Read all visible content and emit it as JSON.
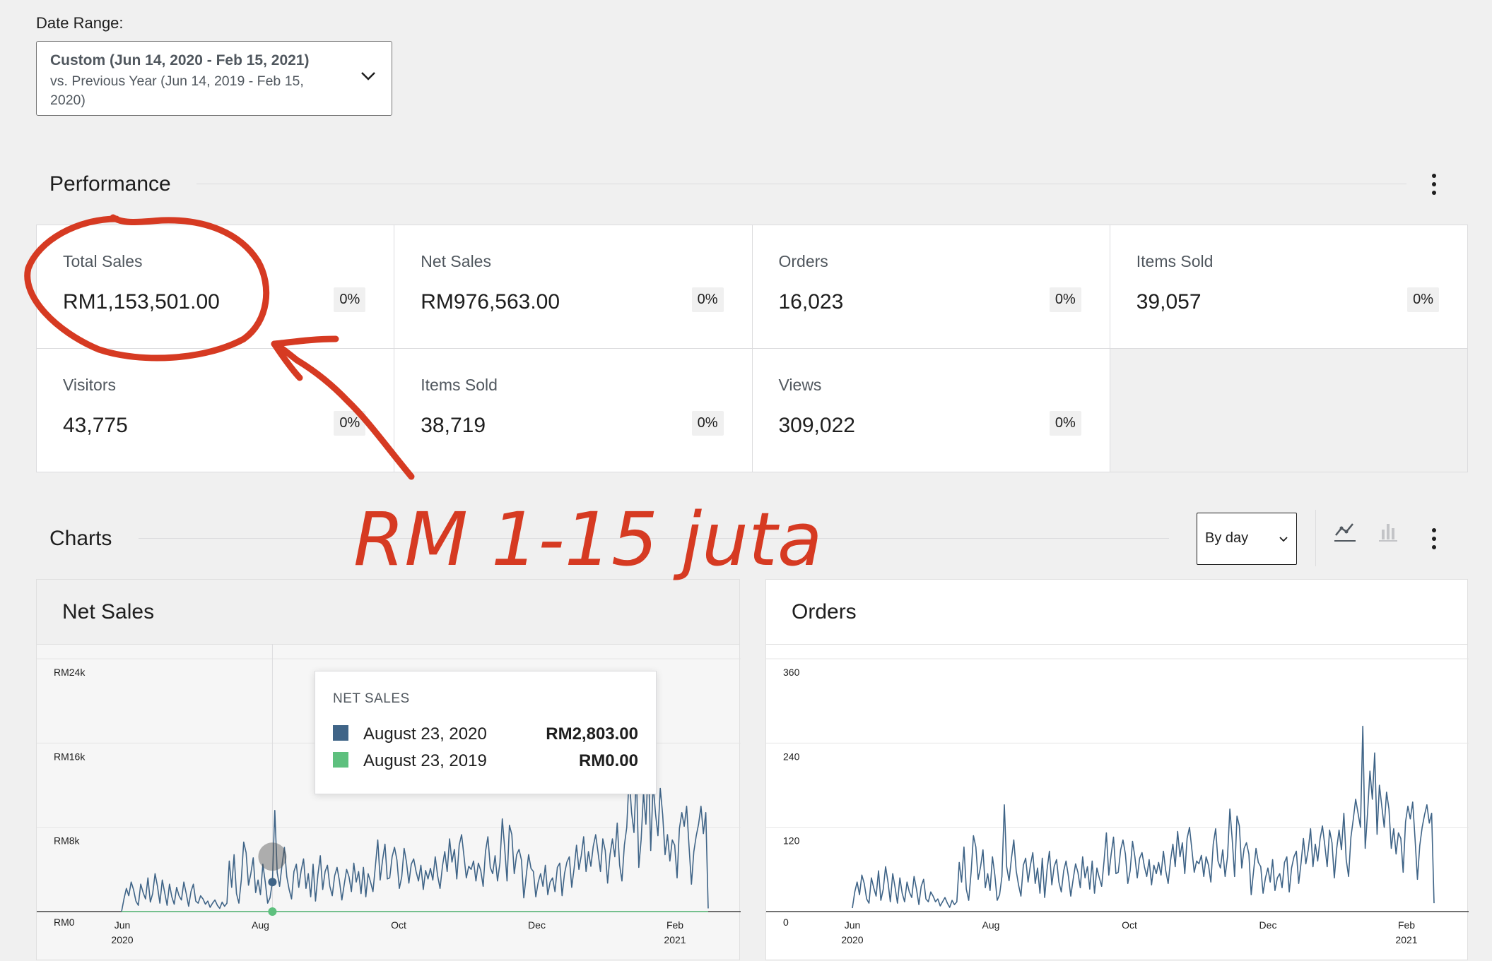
{
  "date_range": {
    "label": "Date Range:",
    "main": "Custom (Jun 14, 2020 - Feb 15, 2021)",
    "compare": "vs. Previous Year (Jun 14, 2019 - Feb 15, 2020)"
  },
  "performance": {
    "title": "Performance",
    "cards": [
      {
        "label": "Total Sales",
        "value": "RM1,153,501.00",
        "delta": "0%"
      },
      {
        "label": "Net Sales",
        "value": "RM976,563.00",
        "delta": "0%"
      },
      {
        "label": "Orders",
        "value": "16,023",
        "delta": "0%"
      },
      {
        "label": "Items Sold",
        "value": "39,057",
        "delta": "0%"
      },
      {
        "label": "Visitors",
        "value": "43,775",
        "delta": "0%"
      },
      {
        "label": "Items Sold",
        "value": "38,719",
        "delta": "0%"
      },
      {
        "label": "Views",
        "value": "309,022",
        "delta": "0%"
      }
    ]
  },
  "charts_section": {
    "title": "Charts",
    "interval": "By day"
  },
  "annotation": {
    "text": "RM 1-15 juta",
    "color": "#d63a22"
  },
  "colors": {
    "primary_series": "#3f6487",
    "compare_series": "#5ec07e",
    "gridline": "#e5e5e5"
  },
  "tooltip": {
    "title": "NET SALES",
    "rows": [
      {
        "date": "August 23, 2020",
        "value": "RM2,803.00",
        "color": "#3f6487"
      },
      {
        "date": "August 23, 2019",
        "value": "RM0.00",
        "color": "#5ec07e"
      }
    ]
  },
  "chart_data": [
    {
      "type": "line",
      "title": "Net Sales",
      "ylim": [
        0,
        24000
      ],
      "y_ticks": [
        "RM0",
        "RM8k",
        "RM16k",
        "RM24k"
      ],
      "x_ticks": [
        {
          "label": "Jun",
          "sub": "2020"
        },
        {
          "label": "Aug",
          "sub": ""
        },
        {
          "label": "Oct",
          "sub": ""
        },
        {
          "label": "Dec",
          "sub": ""
        },
        {
          "label": "Feb",
          "sub": "2021"
        }
      ],
      "x_range": [
        "2020-06-14",
        "2021-02-15"
      ],
      "series": [
        {
          "name": "August 23, 2020",
          "values": [
            0,
            1200,
            2200,
            1500,
            2800,
            2100,
            1000,
            600,
            2600,
            1800,
            1200,
            3200,
            900,
            1700,
            3600,
            2400,
            800,
            3000,
            1800,
            600,
            2600,
            1400,
            700,
            2300,
            1500,
            1100,
            2800,
            1700,
            500,
            1900,
            2600,
            1000,
            800,
            1500,
            1200,
            700,
            1000,
            400,
            800,
            1100,
            600,
            300,
            900,
            500,
            800,
            4800,
            2300,
            5400,
            1700,
            800,
            3000,
            6600,
            5600,
            2500,
            3600,
            5100,
            1800,
            3000,
            1600,
            4500,
            2800,
            800,
            1300,
            2803,
            9600,
            3700,
            2400,
            4400,
            6100,
            3300,
            2100,
            1200,
            3800,
            4500,
            2300,
            3900,
            5000,
            2200,
            3600,
            1400,
            4500,
            1000,
            3500,
            5300,
            2100,
            3800,
            4400,
            2400,
            1500,
            3400,
            4200,
            2900,
            1100,
            2600,
            4000,
            3300,
            1900,
            4600,
            2800,
            3800,
            1700,
            4200,
            1400,
            3600,
            2800,
            1900,
            4300,
            6800,
            3000,
            4900,
            6400,
            3100,
            3200,
            5200,
            6100,
            4900,
            2200,
            3300,
            6000,
            4700,
            2700,
            4500,
            5000,
            3800,
            2900,
            4400,
            2100,
            3900,
            3100,
            4100,
            3000,
            5200,
            3400,
            2200,
            4300,
            5700,
            3800,
            6900,
            4700,
            5900,
            3100,
            6300,
            7300,
            5300,
            3200,
            4300,
            4000,
            4800,
            2900,
            4600,
            3900,
            2400,
            5700,
            7100,
            4200,
            3600,
            5300,
            2900,
            4600,
            8800,
            6100,
            2900,
            8200,
            7300,
            3600,
            5400,
            5900,
            4900,
            1300,
            3400,
            5400,
            4100,
            3800,
            1400,
            2800,
            3600,
            2400,
            4400,
            1600,
            2800,
            3200,
            1900,
            4200,
            4600,
            1500,
            3600,
            4700,
            5200,
            2300,
            4100,
            6300,
            4000,
            5300,
            7100,
            3800,
            5700,
            4300,
            6200,
            7300,
            5600,
            3800,
            6900,
            5800,
            2700,
            5400,
            6900,
            5200,
            8400,
            4400,
            2900,
            6300,
            8000,
            12900,
            9400,
            7500,
            13100,
            4200,
            6800,
            11300,
            8300,
            14400,
            5800,
            12100,
            9300,
            7200,
            11700,
            9200,
            5400,
            7300,
            4800,
            6800,
            6300,
            3200,
            7900,
            9400,
            8100,
            10000,
            6200,
            2600,
            5700,
            7200,
            8300,
            10000,
            7400,
            9400,
            300
          ]
        },
        {
          "name": "August 23, 2019",
          "values": [
            0
          ]
        }
      ]
    },
    {
      "type": "line",
      "title": "Orders",
      "ylim": [
        0,
        360
      ],
      "y_ticks": [
        "0",
        "120",
        "240",
        "360"
      ],
      "x_ticks": [
        {
          "label": "Jun",
          "sub": "2020"
        },
        {
          "label": "Aug",
          "sub": ""
        },
        {
          "label": "Oct",
          "sub": ""
        },
        {
          "label": "Dec",
          "sub": ""
        },
        {
          "label": "Feb",
          "sub": "2021"
        }
      ],
      "x_range": [
        "2020-06-14",
        "2021-02-15"
      ],
      "series": [
        {
          "name": "Orders",
          "values": [
            5,
            28,
            42,
            24,
            52,
            40,
            18,
            12,
            48,
            34,
            22,
            58,
            16,
            32,
            64,
            42,
            14,
            54,
            34,
            12,
            48,
            26,
            14,
            42,
            28,
            20,
            50,
            32,
            10,
            36,
            46,
            18,
            14,
            28,
            22,
            14,
            18,
            8,
            14,
            20,
            12,
            6,
            16,
            10,
            14,
            70,
            42,
            92,
            32,
            16,
            56,
            108,
            92,
            46,
            64,
            88,
            34,
            54,
            30,
            78,
            52,
            16,
            24,
            50,
            152,
            64,
            44,
            76,
            102,
            58,
            38,
            22,
            66,
            76,
            42,
            66,
            84,
            40,
            62,
            26,
            76,
            20,
            60,
            86,
            38,
            64,
            74,
            42,
            28,
            58,
            72,
            50,
            22,
            46,
            68,
            56,
            34,
            78,
            48,
            64,
            32,
            72,
            26,
            62,
            48,
            36,
            72,
            112,
            52,
            82,
            106,
            54,
            56,
            88,
            102,
            82,
            40,
            58,
            100,
            78,
            48,
            76,
            84,
            64,
            50,
            74,
            38,
            66,
            54,
            70,
            52,
            86,
            58,
            40,
            72,
            96,
            64,
            114,
            78,
            98,
            54,
            104,
            120,
            88,
            56,
            72,
            68,
            80,
            50,
            78,
            66,
            42,
            96,
            118,
            72,
            62,
            88,
            50,
            78,
            146,
            102,
            50,
            136,
            122,
            62,
            90,
            98,
            82,
            24,
            58,
            90,
            70,
            64,
            26,
            48,
            62,
            42,
            74,
            30,
            48,
            54,
            34,
            70,
            78,
            28,
            62,
            78,
            86,
            40,
            70,
            104,
            68,
            88,
            118,
            64,
            96,
            72,
            104,
            122,
            94,
            64,
            116,
            98,
            48,
            90,
            116,
            88,
            140,
            74,
            50,
            106,
            132,
            160,
            140,
            120,
            264,
            90,
            140,
            200,
            160,
            226,
            110,
            180,
            150,
            120,
            170,
            146,
            90,
            118,
            82,
            112,
            104,
            56,
            128,
            150,
            132,
            156,
            104,
            46,
            94,
            120,
            138,
            152,
            126,
            140,
            12
          ]
        }
      ]
    }
  ]
}
